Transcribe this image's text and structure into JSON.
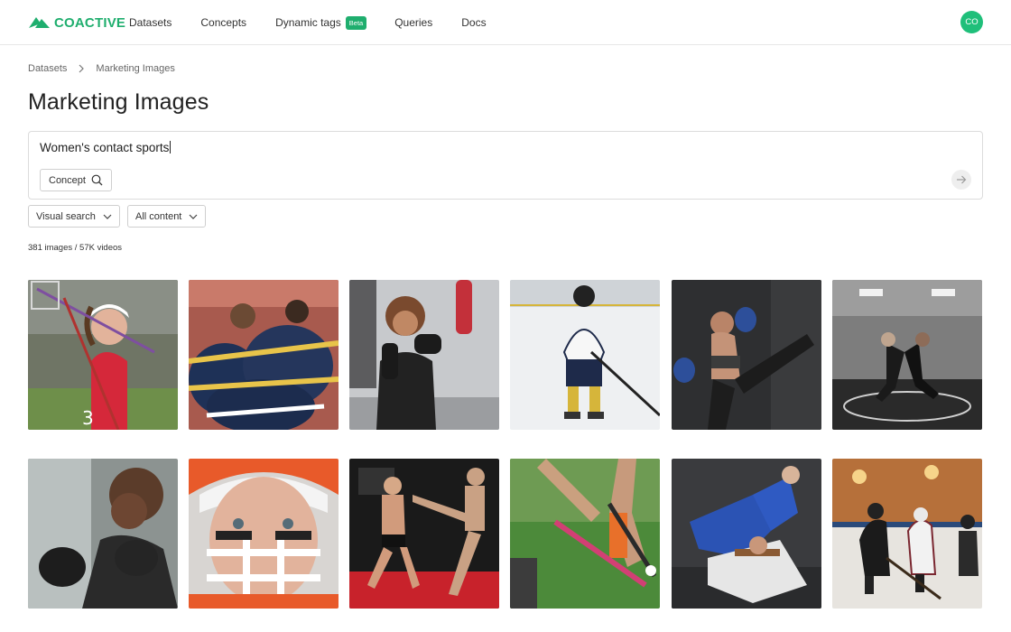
{
  "app": {
    "brand": "COACTIVE",
    "brand_color": "#1fae6e"
  },
  "nav": {
    "items": [
      {
        "label": "Datasets"
      },
      {
        "label": "Concepts"
      },
      {
        "label": "Dynamic tags",
        "badge": "Beta"
      },
      {
        "label": "Queries"
      },
      {
        "label": "Docs"
      }
    ],
    "avatar_initials": "CO"
  },
  "breadcrumb": {
    "items": [
      "Datasets",
      "Marketing Images"
    ],
    "separator_icon": "chevron-right-icon"
  },
  "page": {
    "title": "Marketing Images"
  },
  "search": {
    "query": "Women's contact sports",
    "concept_button": "Concept",
    "concept_icon": "search-icon",
    "submit_icon": "arrow-right-icon"
  },
  "filters": {
    "visual_search": "Visual search",
    "content": "All content"
  },
  "results": {
    "count_text": "381 images / 57K videos"
  },
  "images": [
    {
      "subject": "lacrosse player in red jersey"
    },
    {
      "subject": "rugby team huddle"
    },
    {
      "subject": "boxer in gym"
    },
    {
      "subject": "ice hockey player on rink"
    },
    {
      "subject": "kickboxer high kick"
    },
    {
      "subject": "wrestlers on mat"
    },
    {
      "subject": "boxer training"
    },
    {
      "subject": "football helmet close-up"
    },
    {
      "subject": "kickboxing sparring"
    },
    {
      "subject": "field hockey sticks"
    },
    {
      "subject": "judo throw"
    },
    {
      "subject": "ice hockey game"
    }
  ]
}
